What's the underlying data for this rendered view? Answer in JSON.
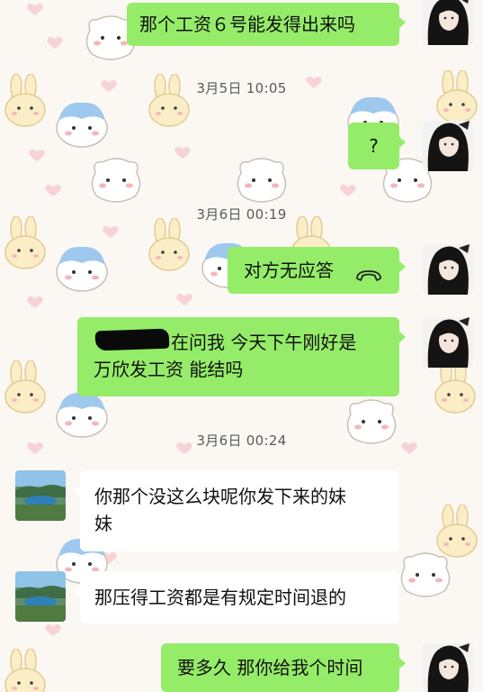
{
  "messages": [
    {
      "id": "m1",
      "side": "out",
      "text": "那个工资６号能发得出来吗"
    },
    {
      "id": "t1",
      "type": "time",
      "text": "3月5日 10:05"
    },
    {
      "id": "m2",
      "side": "out",
      "text": "?"
    },
    {
      "id": "t2",
      "type": "time",
      "text": "3月6日 00:19"
    },
    {
      "id": "m3",
      "side": "out",
      "text": "对方无应答",
      "icon": "phone-hangup-icon"
    },
    {
      "id": "m4",
      "side": "out",
      "line1": "在问我 今天下午刚好是",
      "line2": "万欣发工资 能结吗"
    },
    {
      "id": "t3",
      "type": "time",
      "text": "3月6日 00:24"
    },
    {
      "id": "m5",
      "side": "in",
      "line1": "你那个没这么块呢你发下来的妹",
      "line2": "妹"
    },
    {
      "id": "m6",
      "side": "in",
      "text": "那压得工资都是有规定时间退的"
    },
    {
      "id": "m7",
      "side": "out",
      "text": "要多久 那你给我个时间"
    }
  ],
  "colors": {
    "outgoing": "#95ec69",
    "incoming": "#ffffff",
    "background": "#fbf8f4"
  }
}
